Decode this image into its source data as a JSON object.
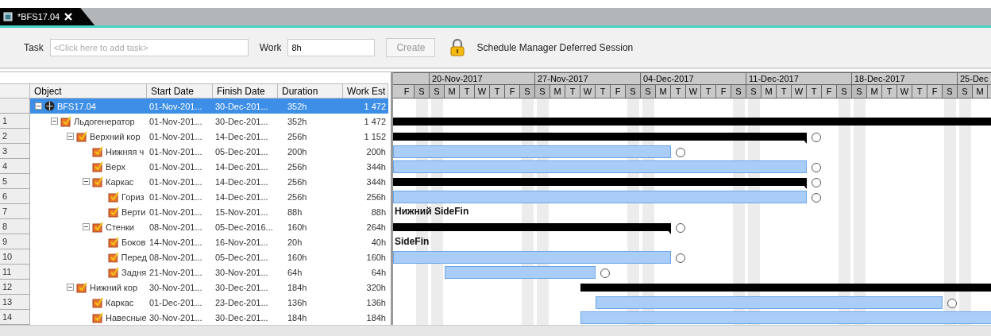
{
  "tab": {
    "title": "*BFS17.04",
    "selected": true
  },
  "toolbar": {
    "task_label": "Task",
    "task_field": {
      "placeholder": "<Click here to add task>"
    },
    "work_label": "Work",
    "work_field": {
      "value": "8h"
    },
    "create_button": {
      "label": "Create",
      "disabled": true
    },
    "session": "Schedule Manager Deferred Session"
  },
  "table": {
    "columns": [
      "Object",
      "Start Date",
      "Finish Date",
      "Duration",
      "Work Est"
    ],
    "rows": [
      {
        "kind": "project",
        "object": "BFS17.04",
        "start_date": "01-Nov-201...",
        "finish_date": "30-Dec-201...",
        "duration": "352h",
        "work_est": "1 472",
        "selected": true,
        "expanded": true,
        "children": [
          {
            "kind": "task",
            "number": "1",
            "object": "Льдогенератор",
            "start_date": "01-Nov-201...",
            "finish_date": "30-Dec-201...",
            "duration": "352h",
            "work_est": "1 472",
            "selected": false,
            "expanded": true,
            "children": [
              {
                "kind": "task",
                "number": "2",
                "object": "Верхний кор",
                "start_date": "01-Nov-201...",
                "finish_date": "14-Dec-201...",
                "duration": "256h",
                "work_est": "1 152",
                "selected": false,
                "expanded": true,
                "children": [
                  {
                    "kind": "task",
                    "number": "3",
                    "object": "Нижняя ч",
                    "start_date": "01-Nov-201...",
                    "finish_date": "05-Dec-201...",
                    "duration": "200h",
                    "work_est": "200h",
                    "selected": false
                  },
                  {
                    "kind": "task",
                    "number": "4",
                    "object": "Верх",
                    "start_date": "01-Nov-201...",
                    "finish_date": "14-Dec-201...",
                    "duration": "256h",
                    "work_est": "344h",
                    "selected": false
                  },
                  {
                    "kind": "task",
                    "number": "5",
                    "object": "Каркас",
                    "start_date": "01-Nov-201...",
                    "finish_date": "14-Dec-201...",
                    "duration": "256h",
                    "work_est": "344h",
                    "selected": false,
                    "expanded": true,
                    "children": [
                      {
                        "kind": "task",
                        "number": "6",
                        "object": "Гориз",
                        "start_date": "01-Nov-201...",
                        "finish_date": "14-Dec-201...",
                        "duration": "256h",
                        "work_est": "256h",
                        "selected": false
                      },
                      {
                        "kind": "task",
                        "number": "7",
                        "object": "Верти",
                        "start_date": "01-Nov-201...",
                        "finish_date": "15-Nov-201...",
                        "duration": "88h",
                        "work_est": "88h",
                        "selected": false,
                        "bar_label": "Нижний SideFin"
                      }
                    ]
                  },
                  {
                    "kind": "task",
                    "number": "8",
                    "object": "Стенки",
                    "start_date": "08-Nov-201...",
                    "finish_date": "05-Dec-2016...",
                    "duration": "160h",
                    "work_est": "264h",
                    "selected": false,
                    "expanded": true,
                    "children": [
                      {
                        "kind": "task",
                        "number": "9",
                        "object": "Боков",
                        "start_date": "14-Nov-201...",
                        "finish_date": "16-Nov-201...",
                        "duration": "20h",
                        "work_est": "40h",
                        "selected": false,
                        "bar_label": "SideFin"
                      },
                      {
                        "kind": "task",
                        "number": "10",
                        "object": "Перед",
                        "start_date": "08-Nov-201...",
                        "finish_date": "05-Dec-201...",
                        "duration": "160h",
                        "work_est": "160h",
                        "selected": false
                      },
                      {
                        "kind": "task",
                        "number": "11",
                        "object": "Задня",
                        "start_date": "21-Nov-201...",
                        "finish_date": "30-Nov-201...",
                        "duration": "64h",
                        "work_est": "64h",
                        "selected": false
                      }
                    ]
                  }
                ]
              },
              {
                "kind": "task",
                "number": "12",
                "object": "Нижний кор",
                "start_date": "30-Nov-201...",
                "finish_date": "30-Dec-201...",
                "duration": "184h",
                "work_est": "320h",
                "selected": false,
                "expanded": true,
                "children": [
                  {
                    "kind": "task",
                    "number": "13",
                    "object": "Каркас",
                    "start_date": "01-Dec-201...",
                    "finish_date": "23-Dec-201...",
                    "duration": "136h",
                    "work_est": "136h",
                    "selected": false
                  },
                  {
                    "kind": "task",
                    "number": "14",
                    "object": "Навесные",
                    "start_date": "30-Nov-201...",
                    "finish_date": "30-Dec-201...",
                    "duration": "184h",
                    "work_est": "184h",
                    "selected": false
                  }
                ]
              }
            ]
          }
        ]
      }
    ]
  },
  "gantt": {
    "weeks": [
      "20-Nov-2017",
      "27-Nov-2017",
      "04-Dec-2017",
      "11-Dec-2017",
      "18-Dec-2017",
      "25-Dec"
    ],
    "days": [
      {
        "letter": "F",
        "weekend": false
      },
      {
        "letter": "S",
        "weekend": true
      },
      {
        "letter": "S",
        "weekend": true
      },
      {
        "letter": "M",
        "weekend": false
      },
      {
        "letter": "T",
        "weekend": false
      },
      {
        "letter": "W",
        "weekend": false
      },
      {
        "letter": "T",
        "weekend": false
      },
      {
        "letter": "F",
        "weekend": false
      },
      {
        "letter": "S",
        "weekend": true
      },
      {
        "letter": "S",
        "weekend": true
      },
      {
        "letter": "M",
        "weekend": false
      },
      {
        "letter": "T",
        "weekend": false
      },
      {
        "letter": "W",
        "weekend": false
      },
      {
        "letter": "T",
        "weekend": false
      },
      {
        "letter": "F",
        "weekend": false
      },
      {
        "letter": "S",
        "weekend": true
      },
      {
        "letter": "S",
        "weekend": true
      },
      {
        "letter": "M",
        "weekend": false
      },
      {
        "letter": "T",
        "weekend": false
      },
      {
        "letter": "W",
        "weekend": false
      },
      {
        "letter": "T",
        "weekend": false
      },
      {
        "letter": "F",
        "weekend": false
      },
      {
        "letter": "S",
        "weekend": true
      },
      {
        "letter": "S",
        "weekend": true
      },
      {
        "letter": "M",
        "weekend": false
      },
      {
        "letter": "T",
        "weekend": false
      },
      {
        "letter": "W",
        "weekend": false
      },
      {
        "letter": "T",
        "weekend": false
      },
      {
        "letter": "F",
        "weekend": false
      },
      {
        "letter": "S",
        "weekend": true
      },
      {
        "letter": "S",
        "weekend": true
      },
      {
        "letter": "M",
        "weekend": false
      },
      {
        "letter": "T",
        "weekend": false
      },
      {
        "letter": "W",
        "weekend": false
      },
      {
        "letter": "T",
        "weekend": false
      },
      {
        "letter": "F",
        "weekend": false
      },
      {
        "letter": "S",
        "weekend": true
      },
      {
        "letter": "S",
        "weekend": true
      },
      {
        "letter": "M",
        "weekend": false
      }
    ]
  }
}
